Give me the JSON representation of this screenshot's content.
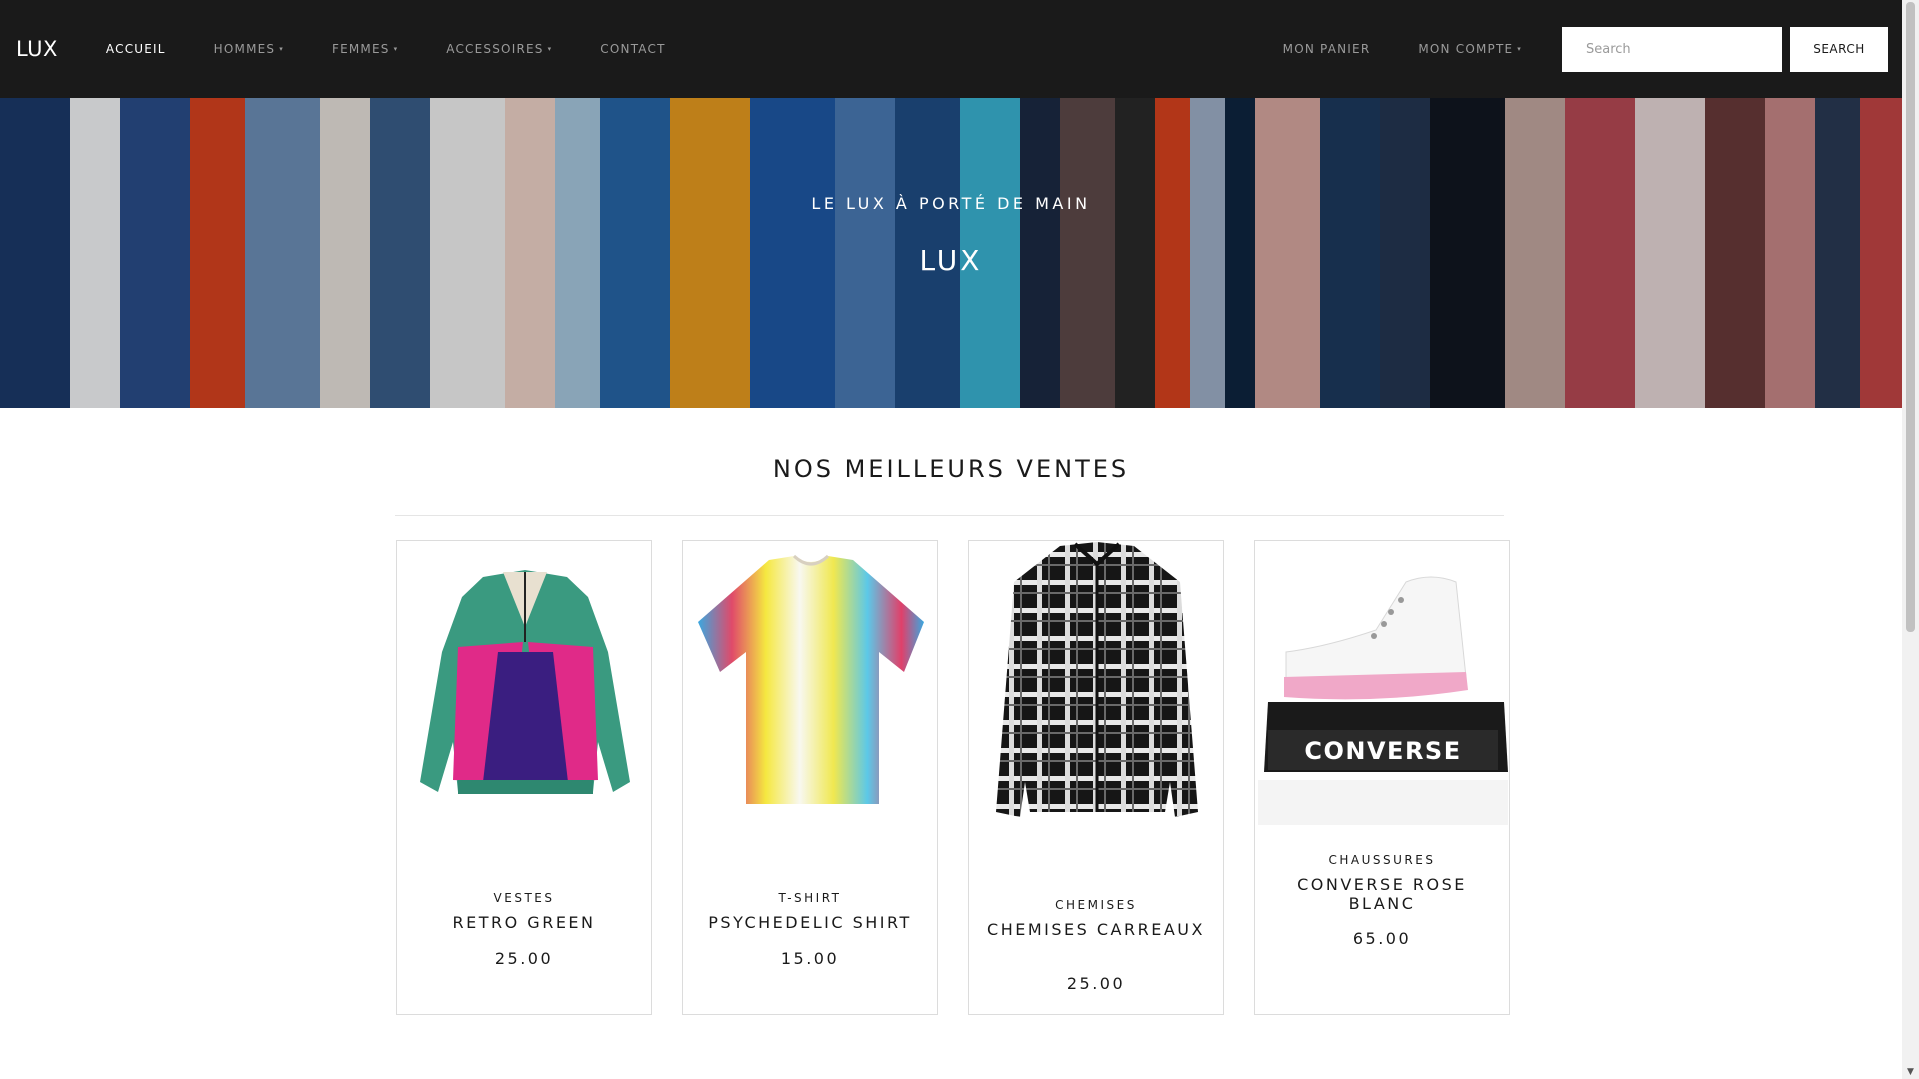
{
  "navbar": {
    "brand": "LUX",
    "left_items": [
      {
        "label": "ACCUEIL",
        "active": true,
        "has_dropdown": false
      },
      {
        "label": "HOMMES",
        "active": false,
        "has_dropdown": true
      },
      {
        "label": "FEMMES",
        "active": false,
        "has_dropdown": true
      },
      {
        "label": "ACCESSOIRES",
        "active": false,
        "has_dropdown": true
      },
      {
        "label": "CONTACT",
        "active": false,
        "has_dropdown": false
      }
    ],
    "cart_label": "MON PANIER",
    "account_label": "MON COMPTE",
    "search_placeholder": "Search",
    "search_button": "SEARCH",
    "caret": "▾"
  },
  "hero": {
    "subtitle": "LE LUX À PORTÉ DE MAIN",
    "title": "LUX"
  },
  "section": {
    "title": "NOS MEILLEURS VENTES"
  },
  "products": [
    {
      "category": "VESTES",
      "name": "RETRO GREEN",
      "price": "25.00",
      "icon": "jacket-image"
    },
    {
      "category": "T-SHIRT",
      "name": "PSYCHEDELIC SHIRT",
      "price": "15.00",
      "icon": "tshirt-image"
    },
    {
      "category": "CHEMISES",
      "name": "CHEMISES CARREAUX",
      "price": "25.00",
      "icon": "shirt-image"
    },
    {
      "category": "CHAUSSURES",
      "name": "CONVERSE ROSE BLANC",
      "price": "65.00",
      "icon": "sneaker-image",
      "box_text": "CONVERSE"
    }
  ],
  "colors": {
    "navbar_bg": "#1a1a1a",
    "nav_text": "#9a9a9a",
    "nav_active": "#ffffff",
    "card_border": "#dcdcdc"
  }
}
